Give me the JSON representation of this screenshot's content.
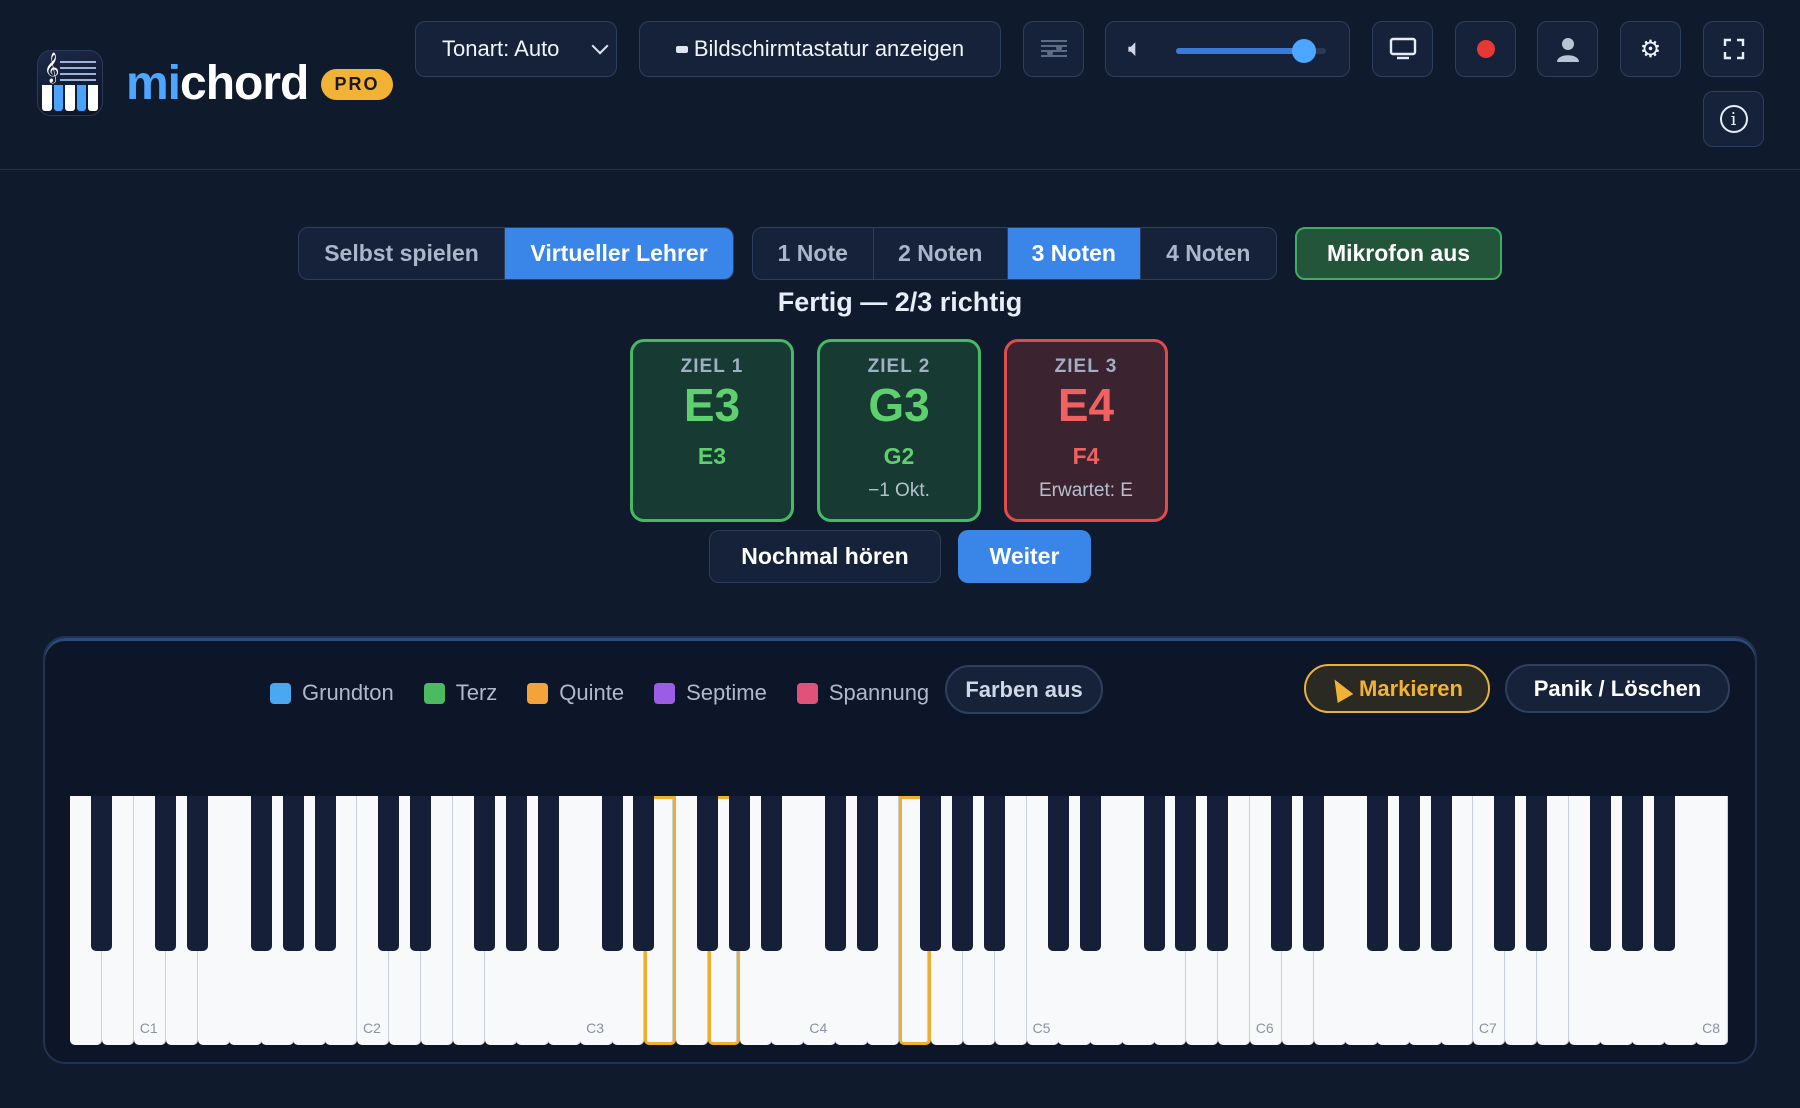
{
  "app": {
    "brand_part1": "mi",
    "brand_part2": "chord",
    "badge": "PRO"
  },
  "toolbar": {
    "key_select_label": "Tonart: Auto",
    "keyboard_button_label": "Bildschirmtastatur anzeigen",
    "volume_level": 0.85,
    "icons": [
      "sheet-music-icon",
      "speaker-icon",
      "monitor-icon",
      "record-icon",
      "user-icon",
      "gear-icon",
      "fullscreen-icon",
      "info-icon"
    ]
  },
  "modes": {
    "options": [
      "Selbst spielen",
      "Virtueller Lehrer"
    ],
    "selected": "Virtueller Lehrer"
  },
  "note_counts": {
    "options": [
      "1 Note",
      "2 Noten",
      "3 Noten",
      "4 Noten"
    ],
    "selected": "3 Noten"
  },
  "mic_button_label": "Mikrofon aus",
  "status_text": "Fertig — 2/3 richtig",
  "targets": [
    {
      "label": "ZIEL 1",
      "target": "E3",
      "played": "E3",
      "hint": "",
      "correct": true
    },
    {
      "label": "ZIEL 2",
      "target": "G3",
      "played": "G2",
      "hint": "−1 Okt.",
      "correct": true
    },
    {
      "label": "ZIEL 3",
      "target": "E4",
      "played": "F4",
      "hint": "Erwartet: E",
      "correct": false
    }
  ],
  "actions": {
    "again_label": "Nochmal hören",
    "next_label": "Weiter"
  },
  "legend": [
    {
      "label": "Grundton",
      "color": "#4aa8f0"
    },
    {
      "label": "Terz",
      "color": "#4cbb5f"
    },
    {
      "label": "Quinte",
      "color": "#f2a33a"
    },
    {
      "label": "Septime",
      "color": "#9b5de5"
    },
    {
      "label": "Spannung",
      "color": "#e0527a"
    }
  ],
  "panel_buttons": {
    "colors_off_label": "Farben aus",
    "mark_label": "Markieren",
    "panic_label": "Panik / Löschen"
  },
  "keyboard": {
    "octave_labels": [
      "C1",
      "C2",
      "C3",
      "C4",
      "C5",
      "C6",
      "C7",
      "C8"
    ],
    "highlighted_keys": [
      "E3",
      "G3",
      "F4"
    ],
    "highlight_color": "#f0ae2c"
  }
}
